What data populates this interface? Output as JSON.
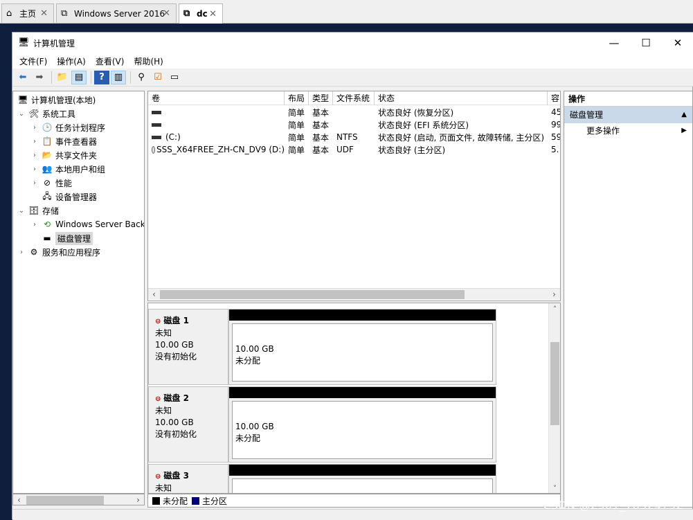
{
  "vm_tabs": [
    {
      "label": "主页",
      "icon": "home-icon"
    },
    {
      "label": "Windows Server 2016",
      "icon": "vm-icon"
    },
    {
      "label": "dc",
      "icon": "vm-icon"
    }
  ],
  "window": {
    "title": "计算机管理"
  },
  "menu": [
    "文件(F)",
    "操作(A)",
    "查看(V)",
    "帮助(H)"
  ],
  "tree": {
    "root": "计算机管理(本地)",
    "system_tools": "系统工具",
    "task_scheduler": "任务计划程序",
    "event_viewer": "事件查看器",
    "shared_folders": "共享文件夹",
    "local_users": "本地用户和组",
    "performance": "性能",
    "device_manager": "设备管理器",
    "storage": "存储",
    "windows_backup": "Windows Server Back",
    "disk_management": "磁盘管理",
    "services_apps": "服务和应用程序"
  },
  "volumes": {
    "headers": [
      "卷",
      "布局",
      "类型",
      "文件系统",
      "状态",
      "容"
    ],
    "rows": [
      {
        "name": "",
        "layout": "简单",
        "type": "基本",
        "fs": "",
        "status": "状态良好 (恢复分区)",
        "cap": "45"
      },
      {
        "name": "",
        "layout": "简单",
        "type": "基本",
        "fs": "",
        "status": "状态良好 (EFI 系统分区)",
        "cap": "99"
      },
      {
        "name": "(C:)",
        "layout": "简单",
        "type": "基本",
        "fs": "NTFS",
        "status": "状态良好 (启动, 页面文件, 故障转储, 主分区)",
        "cap": "59"
      },
      {
        "name": "SSS_X64FREE_ZH-CN_DV9 (D:)",
        "layout": "简单",
        "type": "基本",
        "fs": "UDF",
        "status": "状态良好 (主分区)",
        "cap": "5."
      }
    ]
  },
  "disks": [
    {
      "name": "磁盘 1",
      "kind": "未知",
      "size": "10.00 GB",
      "state": "没有初始化",
      "part_size": "10.00 GB",
      "part_state": "未分配"
    },
    {
      "name": "磁盘 2",
      "kind": "未知",
      "size": "10.00 GB",
      "state": "没有初始化",
      "part_size": "10.00 GB",
      "part_state": "未分配"
    },
    {
      "name": "磁盘 3",
      "kind": "未知",
      "size": "",
      "state": "",
      "part_size": "",
      "part_state": ""
    }
  ],
  "legend": {
    "unallocated": "未分配",
    "primary": "主分区",
    "unallocated_color": "#000000",
    "primary_color": "#00007f"
  },
  "actions": {
    "header": "操作",
    "section": "磁盘管理",
    "more": "更多操作"
  },
  "watermark": "CSDN @2301_78324752"
}
